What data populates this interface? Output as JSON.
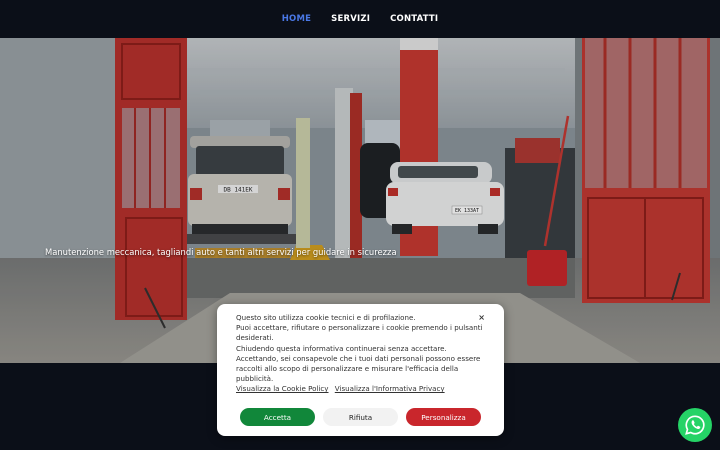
{
  "nav": {
    "items": [
      {
        "label": "HOME"
      },
      {
        "label": "SERVIZI"
      },
      {
        "label": "CONTATTI"
      }
    ],
    "active_color": "#4a78e6"
  },
  "hero": {
    "tagline": "Manutenzione meccanica, tagliandi auto e tanti altri servizi per guidare in sicurezza",
    "plates": [
      "DB 141EK",
      "EK 133AT"
    ]
  },
  "cookie_banner": {
    "lines": [
      "Questo sito utilizza cookie tecnici e di profilazione.",
      "Puoi accettare, rifiutare o personalizzare i cookie premendo i pulsanti desiderati.",
      "Chiudendo questa informativa continuerai senza accettare.",
      "Accettando, sei consapevole che i tuoi dati personali possono essere raccolti allo scopo di personalizzare e misurare l'efficacia della pubblicità."
    ],
    "cookie_policy_link": "Visualizza la Cookie Policy",
    "privacy_link": "Visualizza l'Informativa Privacy",
    "close_label": "×",
    "accept_label": "Accetta",
    "reject_label": "Rifiuta",
    "customize_label": "Personalizza",
    "colors": {
      "accept": "#11873a",
      "reject": "#f2f2f2",
      "customize": "#c9262c"
    }
  },
  "whatsapp": {
    "icon": "whatsapp-icon",
    "color": "#25d366"
  }
}
